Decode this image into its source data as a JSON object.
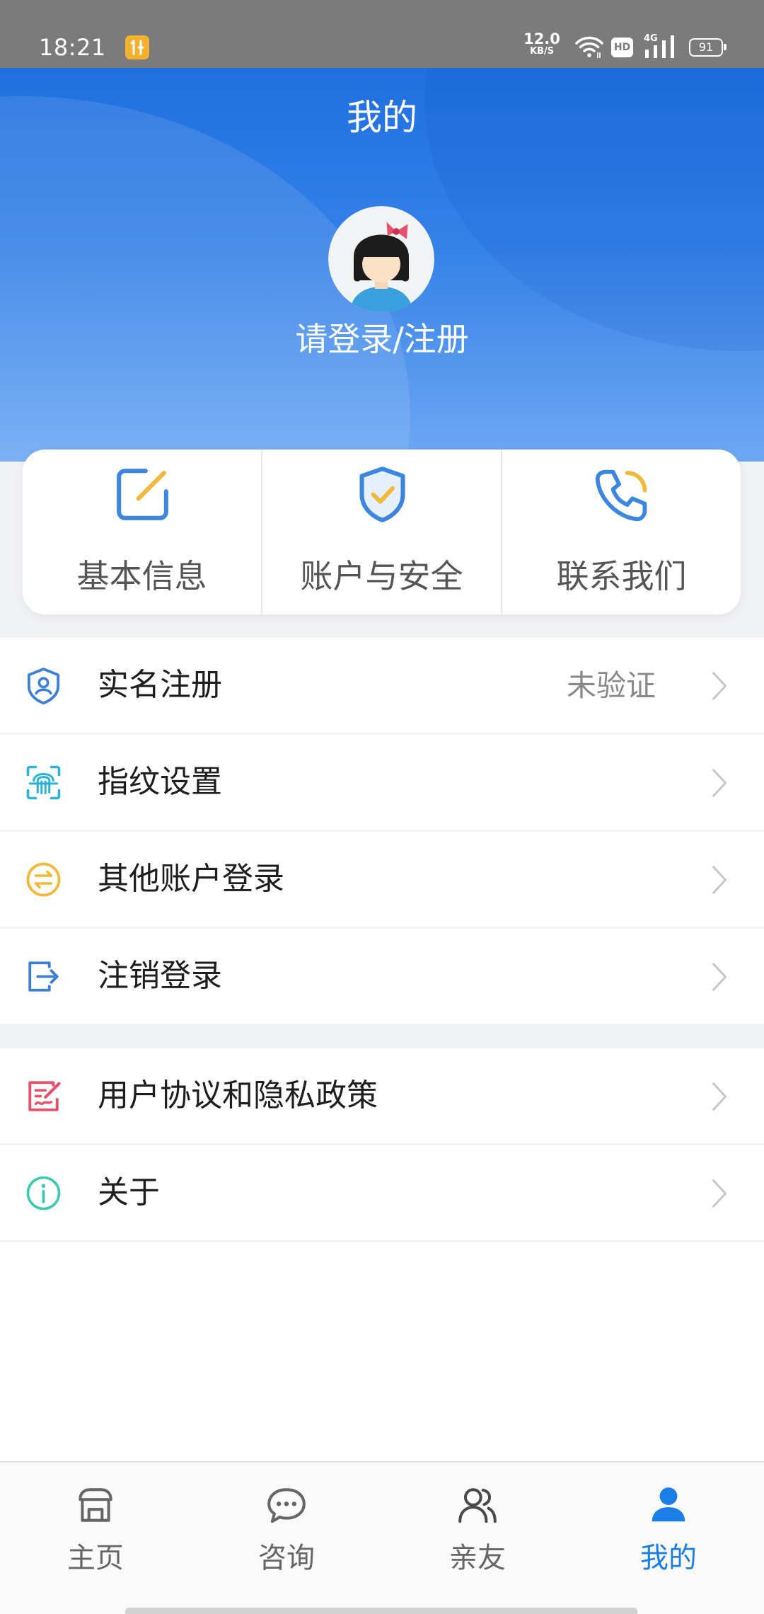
{
  "status_bar": {
    "time": "18:21",
    "net_speed_value": "12.0",
    "net_speed_unit": "KB/S",
    "hd": "HD",
    "network": "4G",
    "battery": "91"
  },
  "header": {
    "title": "我的",
    "login_label": "请登录/注册"
  },
  "quick_actions": [
    {
      "label": "基本信息",
      "icon": "edit-icon"
    },
    {
      "label": "账户与安全",
      "icon": "shield-check-icon"
    },
    {
      "label": "联系我们",
      "icon": "phone-icon"
    }
  ],
  "menu_group_1": [
    {
      "label": "实名注册",
      "value": "未验证",
      "icon": "id-shield-icon"
    },
    {
      "label": "指纹设置",
      "icon": "fingerprint-icon"
    },
    {
      "label": "其他账户登录",
      "icon": "switch-account-icon"
    },
    {
      "label": "注销登录",
      "icon": "logout-icon"
    }
  ],
  "menu_group_2": [
    {
      "label": "用户协议和隐私政策",
      "icon": "agreement-icon"
    },
    {
      "label": "关于",
      "icon": "info-icon"
    }
  ],
  "tab_bar": [
    {
      "label": "主页",
      "icon": "home-icon",
      "active": false
    },
    {
      "label": "咨询",
      "icon": "chat-icon",
      "active": false
    },
    {
      "label": "亲友",
      "icon": "friends-icon",
      "active": false
    },
    {
      "label": "我的",
      "icon": "profile-icon",
      "active": true
    }
  ],
  "colors": {
    "accent": "#1a7ee6",
    "header_top": "#1f6fdf",
    "header_bottom": "#6ea8f3",
    "icon_blue": "#3d86e0",
    "icon_yellow": "#f0b93a",
    "fingerprint": "#2bb3d6",
    "agreement": "#e8506a",
    "info": "#3cc9b0"
  }
}
